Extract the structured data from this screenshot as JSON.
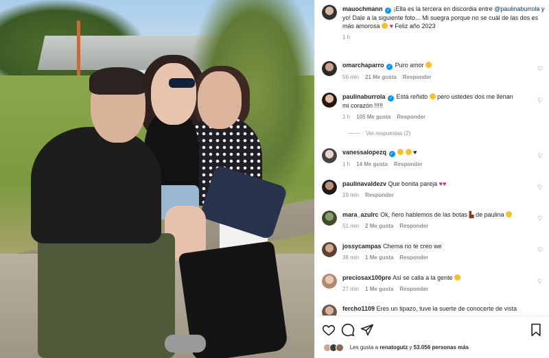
{
  "post": {
    "author": "mauochmann",
    "caption_intro": "¡Ella es la tercera en discordia entre",
    "caption_mention": "@paulinaburrola",
    "caption_rest": "y yo! Dale a la siguiente foto... Mi suegra porque no se cuál de las dos es más amorosa",
    "caption_tail": "Feliz año 2023",
    "time": "1 h"
  },
  "comments": [
    {
      "user": "omarchaparro",
      "verified": true,
      "text": "Puro amor",
      "time": "56 min",
      "likes": "21 Me gusta",
      "reply": "Responder"
    },
    {
      "user": "paulinaburrola",
      "verified": true,
      "text": "Está reñido",
      "text2": "pero ustedes dos me llenan mi corazón !!!!!",
      "time": "1 h",
      "likes": "105 Me gusta",
      "reply": "Responder",
      "view_replies": "Ver respuestas (2)"
    },
    {
      "user": "vanessalopezq",
      "verified": true,
      "text": "",
      "time": "1 h",
      "likes": "14 Me gusta",
      "reply": "Responder"
    },
    {
      "user": "paulinavaldezv",
      "verified": false,
      "text": "Que bonita pareja",
      "time": "19 min",
      "likes": "",
      "reply": "Responder"
    },
    {
      "user": "mara_azulrc",
      "verified": false,
      "text": "Ok, ñero hablemos de las botas",
      "text2": "de paulina",
      "time": "51 min",
      "likes": "2 Me gusta",
      "reply": "Responder"
    },
    {
      "user": "jossycampas",
      "verified": false,
      "text": "Chema no te creo we",
      "time": "38 min",
      "likes": "1 Me gusta",
      "reply": "Responder"
    },
    {
      "user": "preciosax100pre",
      "verified": false,
      "text": "Asi se calla a la gente",
      "time": "27 min",
      "likes": "1 Me gusta",
      "reply": "Responder"
    },
    {
      "user": "fercho1109",
      "verified": false,
      "text": "Eres un tipazo, tuve la suerte de conocerte de vista"
    }
  ],
  "footer": {
    "likes_prefix": "Les gusta a",
    "likes_user": "renatogutz",
    "likes_mid": "y",
    "likes_count": "53.056 personas más"
  },
  "icons": {
    "like": "heart-outline-icon",
    "comment": "comment-bubble-icon",
    "share": "paper-plane-icon",
    "save": "bookmark-icon"
  },
  "colors": {
    "verified": "#0095f6",
    "mention": "#00376b",
    "muted": "#8e8e8e",
    "heart": "#e0245e"
  }
}
